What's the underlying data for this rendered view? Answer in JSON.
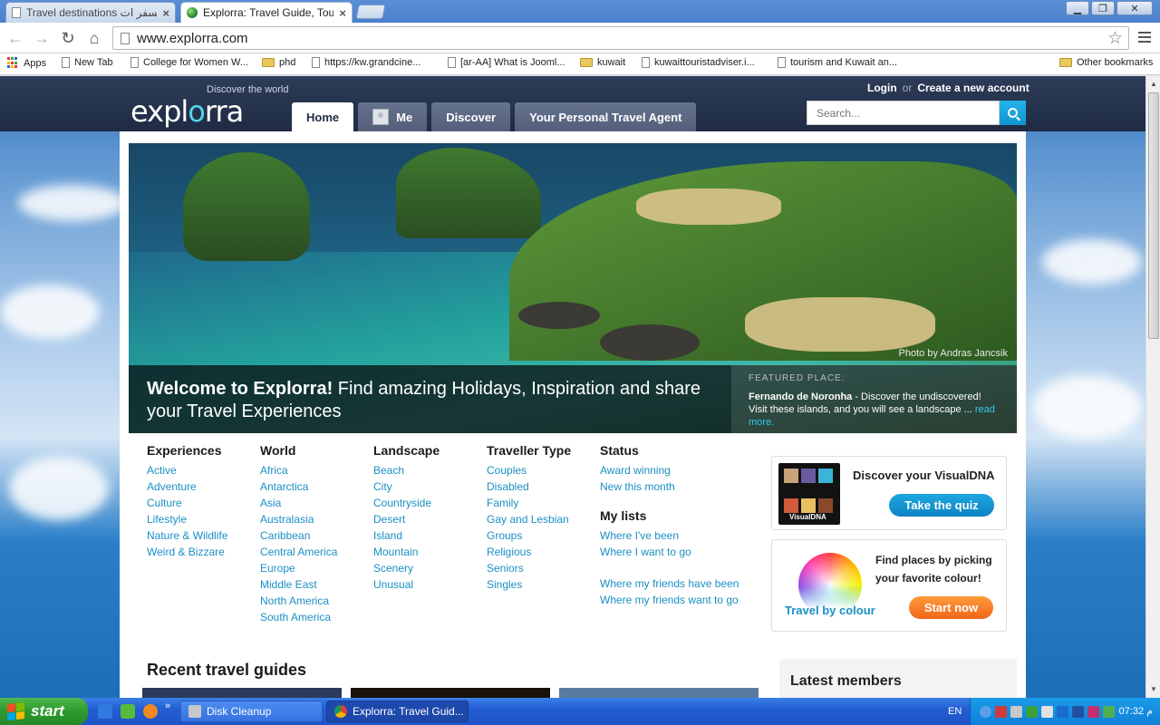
{
  "browser": {
    "tabs": [
      {
        "label": "Travel destinations السفر ات",
        "active": false
      },
      {
        "label": "Explorra: Travel Guide, Touri",
        "active": true
      }
    ],
    "url": "www.explorra.com",
    "window_buttons": {
      "minimize": "▁",
      "restore": "❐",
      "close": "✕"
    },
    "bookmarks": [
      {
        "label": "Apps",
        "icon": "apps-grid-icon"
      },
      {
        "label": "New Tab",
        "icon": "page-icon"
      },
      {
        "label": "College for Women W...",
        "icon": "page-icon"
      },
      {
        "label": "phd",
        "icon": "folder-icon"
      },
      {
        "label": "https://kw.grandcine...",
        "icon": "page-icon"
      },
      {
        "label": "[ar-AA] What is Jooml...",
        "icon": "page-icon"
      },
      {
        "label": "kuwait",
        "icon": "folder-icon"
      },
      {
        "label": "kuwaittouristadviser.i...",
        "icon": "page-icon"
      },
      {
        "label": "tourism and Kuwait an...",
        "icon": "page-icon"
      },
      {
        "label": "Other bookmarks",
        "icon": "folder-icon"
      }
    ]
  },
  "site": {
    "logo": {
      "pre": "expl",
      "oo": "o",
      "post": "rra"
    },
    "tagline": "Discover the world",
    "auth": {
      "login": "Login",
      "or": "or",
      "create": "Create a new account"
    },
    "search_placeholder": "Search...",
    "nav": [
      {
        "label": "Home",
        "active": true
      },
      {
        "label": "Me",
        "active": false
      },
      {
        "label": "Discover",
        "active": false
      },
      {
        "label": "Your Personal Travel Agent",
        "active": false
      }
    ],
    "hero": {
      "photo_credit": "Photo by Andras Jancsik",
      "welcome_bold": "Welcome to Explorra!",
      "welcome_rest": " Find amazing Holidays, Inspiration and share your Travel Experiences",
      "featured_label": "FEATURED PLACE:",
      "featured_place": "Fernando de Noronha",
      "featured_text": " - Discover the undiscovered! Visit these islands, and you will see a landscape ... ",
      "featured_link": "read more."
    },
    "columns": [
      {
        "heading": "Experiences",
        "items": [
          "Active",
          "Adventure",
          "Culture",
          "Lifestyle",
          "Nature & Wildlife",
          "Weird & Bizzare"
        ]
      },
      {
        "heading": "World",
        "items": [
          "Africa",
          "Antarctica",
          "Asia",
          "Australasia",
          "Caribbean",
          "Central America",
          "Europe",
          "Middle East",
          "North America",
          "South America"
        ]
      },
      {
        "heading": "Landscape",
        "items": [
          "Beach",
          "City",
          "Countryside",
          "Desert",
          "Island",
          "Mountain",
          "Scenery",
          "Unusual"
        ]
      },
      {
        "heading": "Traveller Type",
        "items": [
          "Couples",
          "Disabled",
          "Family",
          "Gay and Lesbian",
          "Groups",
          "Religious",
          "Seniors",
          "Singles"
        ]
      }
    ],
    "status": {
      "heading": "Status",
      "items": [
        "Award winning",
        "New this month"
      ],
      "mylists_heading": "My lists",
      "mylists_items": [
        "Where I've been",
        "Where I want to go"
      ],
      "friends_items": [
        "Where my friends have been",
        "Where my friends want to go"
      ]
    },
    "visualdna": {
      "title": "Discover your VisualDNA",
      "button": "Take the quiz",
      "img_label": "VisualDNA"
    },
    "colour": {
      "text": "Find places by picking your favorite colour!",
      "label": "Travel by colour",
      "button": "Start now"
    },
    "recent_heading": "Recent travel guides",
    "members_heading": "Latest members"
  },
  "taskbar": {
    "start": "start",
    "items": [
      {
        "label": "Disk Cleanup",
        "active": false
      },
      {
        "label": "Explorra: Travel Guid...",
        "active": true
      }
    ],
    "lang": "EN",
    "clock": "07:32 م",
    "quicklaunch_more": "»"
  }
}
